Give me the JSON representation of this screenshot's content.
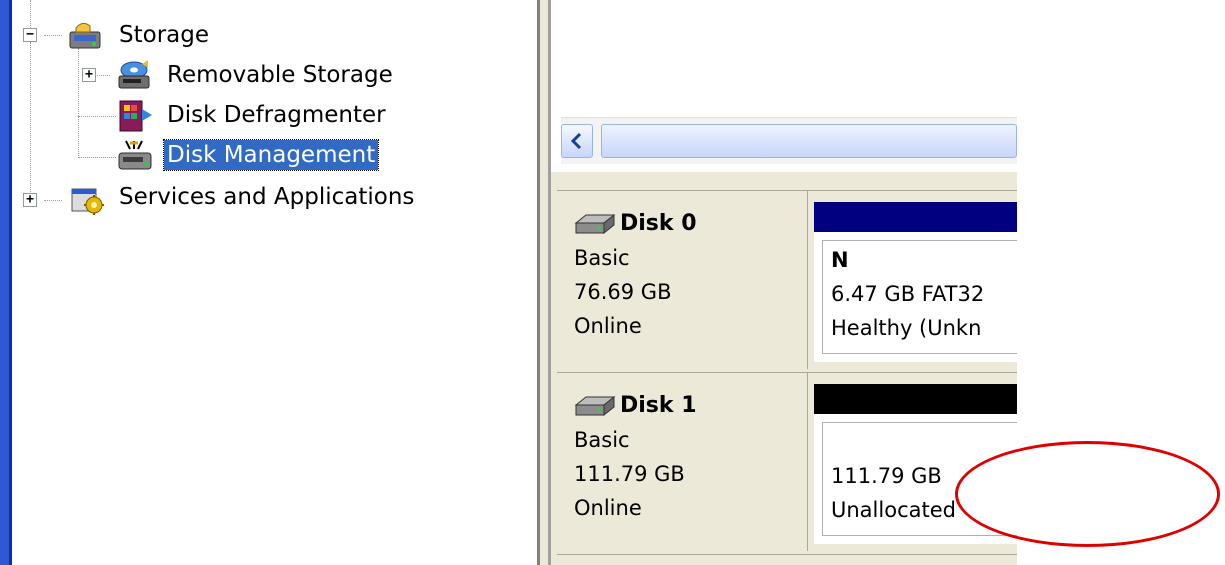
{
  "tree": {
    "items": [
      {
        "label": "Storage",
        "icon": "storage-icon",
        "expander": "−"
      },
      {
        "label": "Removable Storage",
        "icon": "removable-storage-icon",
        "expander": "+"
      },
      {
        "label": "Disk Defragmenter",
        "icon": "disk-defragmenter-icon"
      },
      {
        "label": "Disk Management",
        "icon": "disk-management-icon",
        "selected": true
      },
      {
        "label": "Services and Applications",
        "icon": "services-applications-icon",
        "expander": "+"
      }
    ]
  },
  "scrollbar": {
    "left_arrow": "<"
  },
  "disks": [
    {
      "name": "Disk 0",
      "type": "Basic",
      "size": "76.69 GB",
      "status": "Online",
      "bar_color": "#000080",
      "partition": {
        "letter": "N",
        "detail": "6.47 GB FAT32",
        "health": "Healthy (Unkn"
      }
    },
    {
      "name": "Disk 1",
      "type": "Basic",
      "size": "111.79 GB",
      "status": "Online",
      "bar_color": "#000000",
      "partition": {
        "letter": "",
        "detail": "111.79 GB",
        "health": "Unallocated"
      }
    }
  ],
  "colors": {
    "selection": "#316ac5",
    "annotation": "#e00000",
    "left_strip": "#2d59d6"
  }
}
